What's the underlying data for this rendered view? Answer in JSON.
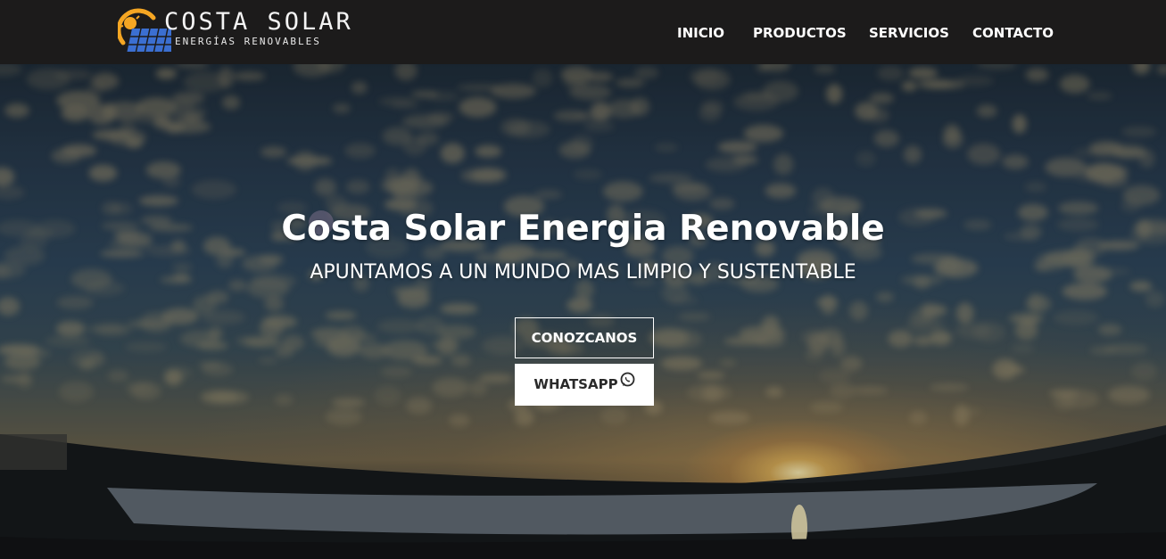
{
  "brand": {
    "title": "COSTA SOLAR",
    "subtitle": "ENERGÍAS RENOVABLES"
  },
  "nav": {
    "items": [
      {
        "label": "INICIO"
      },
      {
        "label": "PRODUCTOS"
      },
      {
        "label": "SERVICIOS"
      },
      {
        "label": "CONTACTO"
      }
    ]
  },
  "hero": {
    "title": "Costa Solar Energia Renovable",
    "subtitle": "APUNTAMOS A UN MUNDO MAS LIMPIO Y SUSTENTABLE",
    "primary_button": "CONOZCANOS",
    "secondary_button": "WHATSAPP",
    "secondary_button_icon": "whatsapp-icon"
  },
  "colors": {
    "navbar_bg": "#1c1b1b",
    "nav_text": "#ffffff",
    "logo_sun": "#f5a623",
    "logo_panel": "#3b6fd1",
    "button_solid_bg": "#ffffff",
    "button_solid_text": "#2a2a2a"
  }
}
